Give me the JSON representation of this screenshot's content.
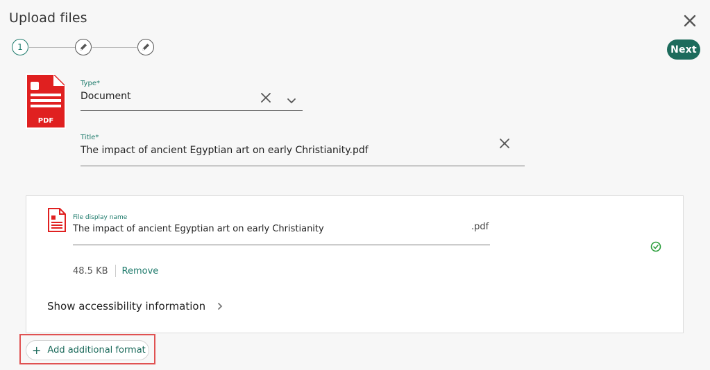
{
  "dialog": {
    "title": "Upload files",
    "next_label": "Next"
  },
  "stepper": {
    "steps": [
      {
        "label": "1",
        "state": "active"
      },
      {
        "label": "",
        "state": "todo",
        "icon": "pencil-icon"
      },
      {
        "label": "",
        "state": "todo",
        "icon": "pencil-icon"
      }
    ]
  },
  "form": {
    "type": {
      "label": "Type*",
      "value": "Document"
    },
    "title": {
      "label": "Title*",
      "value": "The impact of ancient Egyptian art on early Christianity.pdf"
    }
  },
  "file": {
    "icon_text": "PDF",
    "display_name_label": "File display name",
    "display_name": "The impact of ancient Egyptian art on early Christianity",
    "extension": ".pdf",
    "size": "48.5 KB",
    "remove_label": "Remove",
    "accessibility_label": "Show accessibility information"
  },
  "actions": {
    "add_format_label": "Add additional format"
  },
  "colors": {
    "accent": "#1d7a6b",
    "primary_button": "#1d6b5c",
    "pdf_red": "#e02020",
    "highlight": "#e05252",
    "success": "#2a9d3a"
  }
}
